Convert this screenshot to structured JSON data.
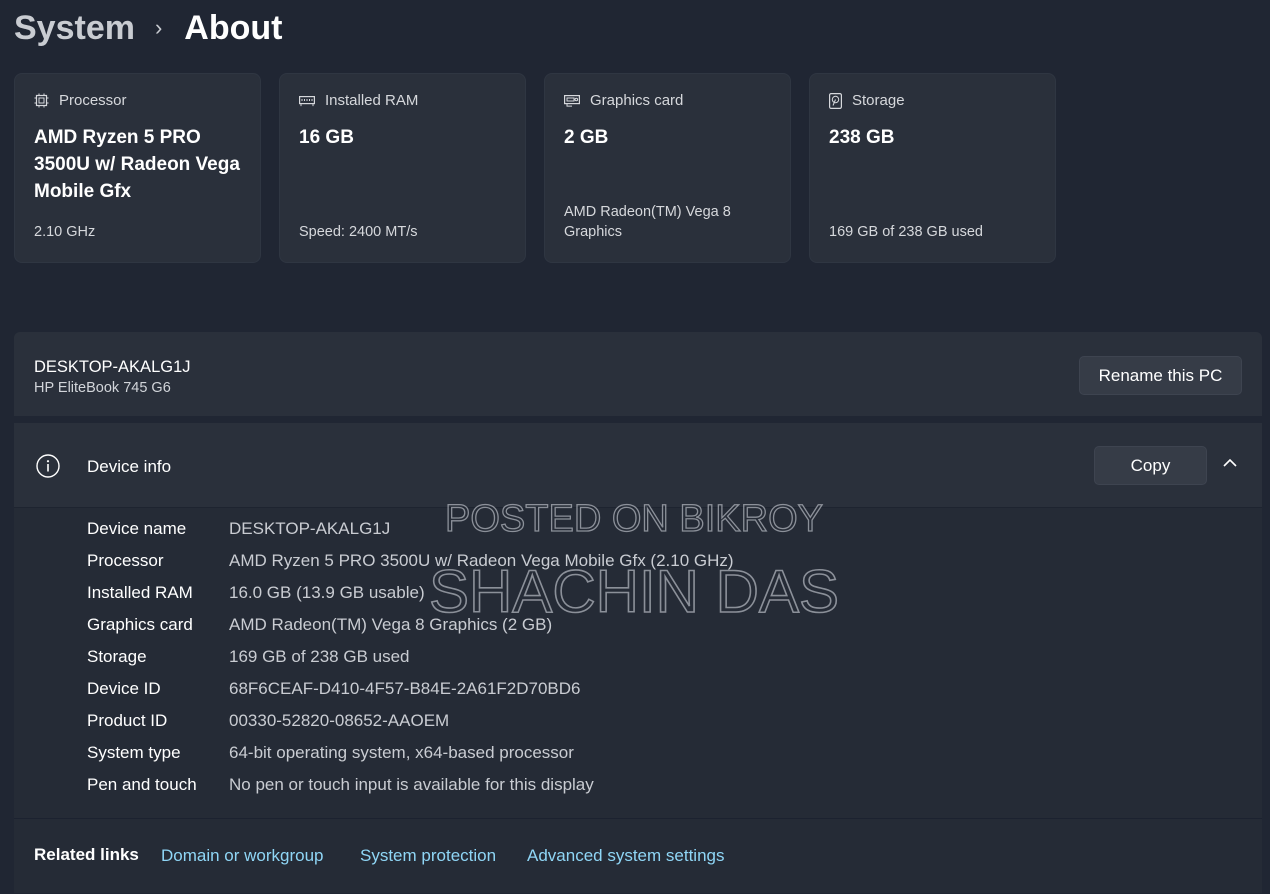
{
  "breadcrumb": {
    "parent": "System",
    "separator": "›",
    "current": "About"
  },
  "cards": [
    {
      "icon": "processor-icon",
      "label": "Processor",
      "value": "AMD Ryzen 5 PRO 3500U w/ Radeon Vega Mobile Gfx",
      "sub": "2.10 GHz"
    },
    {
      "icon": "ram-icon",
      "label": "Installed RAM",
      "value": "16 GB",
      "sub": "Speed: 2400 MT/s"
    },
    {
      "icon": "graphics-card-icon",
      "label": "Graphics card",
      "value": "2 GB",
      "sub": "AMD Radeon(TM) Vega 8 Graphics"
    },
    {
      "icon": "storage-icon",
      "label": "Storage",
      "value": "238 GB",
      "sub": "169 GB of 238 GB used"
    }
  ],
  "pc": {
    "name": "DESKTOP-AKALG1J",
    "model": "HP EliteBook 745 G6",
    "rename_label": "Rename this PC"
  },
  "device_info": {
    "title": "Device info",
    "copy_label": "Copy",
    "specs": [
      {
        "label": "Device name",
        "value": "DESKTOP-AKALG1J"
      },
      {
        "label": "Processor",
        "value": "AMD Ryzen 5 PRO 3500U w/ Radeon Vega Mobile Gfx (2.10 GHz)"
      },
      {
        "label": "Installed RAM",
        "value": "16.0 GB (13.9 GB usable)"
      },
      {
        "label": "Graphics card",
        "value": "AMD Radeon(TM) Vega 8 Graphics (2 GB)"
      },
      {
        "label": "Storage",
        "value": "169 GB of 238 GB used"
      },
      {
        "label": "Device ID",
        "value": "68F6CEAF-D410-4F57-B84E-2A61F2D70BD6"
      },
      {
        "label": "Product ID",
        "value": "00330-52820-08652-AAOEM"
      },
      {
        "label": "System type",
        "value": "64-bit operating system, x64-based processor"
      },
      {
        "label": "Pen and touch",
        "value": "No pen or touch input is available for this display"
      }
    ]
  },
  "related": {
    "label": "Related links",
    "links": [
      "Domain or workgroup",
      "System protection",
      "Advanced system settings"
    ]
  },
  "watermark": {
    "line1": "POSTED ON BIKROY",
    "line2": "SHACHIN DAS"
  },
  "colors": {
    "background": "#202633",
    "card": "#2a303b",
    "link": "#8fd6f6"
  }
}
